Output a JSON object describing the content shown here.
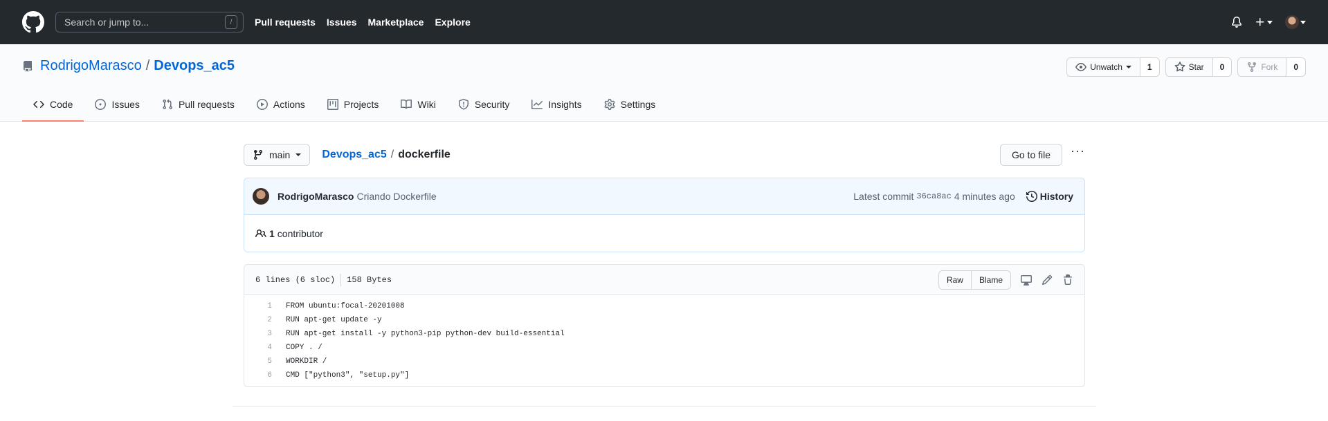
{
  "topbar": {
    "search_placeholder": "Search or jump to...",
    "search_shortcut": "/",
    "nav": [
      "Pull requests",
      "Issues",
      "Marketplace",
      "Explore"
    ]
  },
  "repo": {
    "owner": "RodrigoMarasco",
    "separator": "/",
    "name": "Devops_ac5",
    "watch": {
      "label": "Unwatch",
      "count": "1"
    },
    "star": {
      "label": "Star",
      "count": "0"
    },
    "fork": {
      "label": "Fork",
      "count": "0"
    }
  },
  "tabs": [
    {
      "label": "Code",
      "icon": "code-icon",
      "active": true
    },
    {
      "label": "Issues",
      "icon": "issue-icon"
    },
    {
      "label": "Pull requests",
      "icon": "pull-request-icon"
    },
    {
      "label": "Actions",
      "icon": "play-icon"
    },
    {
      "label": "Projects",
      "icon": "project-icon"
    },
    {
      "label": "Wiki",
      "icon": "book-icon"
    },
    {
      "label": "Security",
      "icon": "shield-icon"
    },
    {
      "label": "Insights",
      "icon": "graph-icon"
    },
    {
      "label": "Settings",
      "icon": "gear-icon"
    }
  ],
  "file": {
    "branch": "main",
    "crumb_repo": "Devops_ac5",
    "crumb_sep": "/",
    "filename": "dockerfile",
    "goto_label": "Go to file",
    "more": "···"
  },
  "commit": {
    "author": "RodrigoMarasco",
    "message": "Criando Dockerfile",
    "latest_label": "Latest commit",
    "sha": "36ca8ac",
    "time": "4 minutes ago",
    "history_label": "History",
    "contributors_count": "1",
    "contributors_label": "contributor"
  },
  "filehead": {
    "lines": "6 lines (6 sloc)",
    "size": "158 Bytes",
    "raw_label": "Raw",
    "blame_label": "Blame"
  },
  "code": [
    {
      "n": "1",
      "text": "FROM ubuntu:focal-20201008"
    },
    {
      "n": "2",
      "text": "RUN apt-get update -y"
    },
    {
      "n": "3",
      "text": "RUN apt-get install -y python3-pip python-dev build-essential"
    },
    {
      "n": "4",
      "text": "COPY . /"
    },
    {
      "n": "5",
      "text": "WORKDIR /"
    },
    {
      "n": "6",
      "text": "CMD [\"python3\", \"setup.py\"]"
    }
  ]
}
